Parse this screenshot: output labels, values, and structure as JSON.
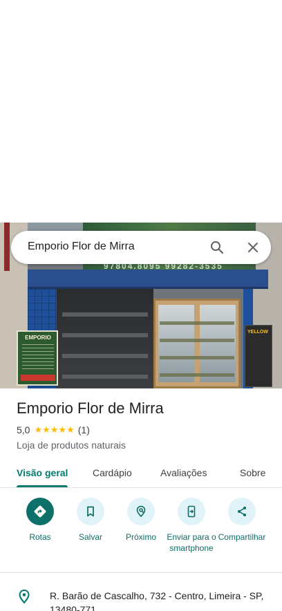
{
  "search": {
    "query": "Emporio Flor de Mirra",
    "search_icon": "search-icon",
    "close_icon": "close-icon"
  },
  "photo": {
    "banner_text": "97804.8095  99282-3535",
    "sign_left_title": "EMPORIO",
    "sign_right_text": "YELLOW"
  },
  "place": {
    "title": "Emporio Flor de Mirra",
    "rating": "5,0",
    "stars": "★★★★★",
    "review_count": "(1)",
    "category": "Loja de produtos naturais"
  },
  "tabs": [
    {
      "label": "Visão geral",
      "active": true
    },
    {
      "label": "Cardápio",
      "active": false
    },
    {
      "label": "Avaliações",
      "active": false
    },
    {
      "label": "Sobre",
      "active": false
    }
  ],
  "actions": [
    {
      "label": "Rotas",
      "icon": "directions-icon"
    },
    {
      "label": "Salvar",
      "icon": "bookmark-icon"
    },
    {
      "label": "Próximo",
      "icon": "nearby-icon"
    },
    {
      "label": "Enviar para o smartphone",
      "icon": "send-to-phone-icon"
    },
    {
      "label": "Compartilhar",
      "icon": "share-icon"
    }
  ],
  "address": {
    "text": "R. Barão de Cascalho, 732 - Centro, Limeira - SP, 13480-771",
    "icon": "location-pin-icon"
  },
  "colors": {
    "accent": "#01796f",
    "action_bg": "#dff3f8",
    "star": "#fbbc04"
  }
}
